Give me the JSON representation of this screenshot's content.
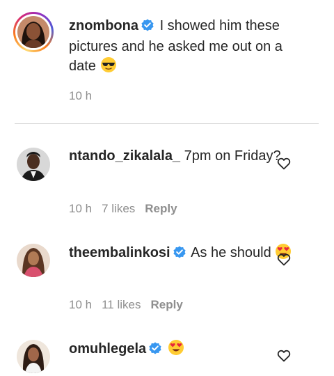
{
  "caption": {
    "username": "znombona",
    "text": "I showed him these pictures and he asked me out on a date",
    "emoji": "sunglasses-emoji",
    "time": "10 h"
  },
  "comments": [
    {
      "username": "ntando_zikalala_",
      "text": "7pm on Friday?",
      "time": "10 h",
      "likes": "7 likes",
      "reply_label": "Reply",
      "verified": false
    },
    {
      "username": "theembalinkosi",
      "text": "As he should",
      "emoji": "heart-eyes-emoji",
      "time": "10 h",
      "likes": "11 likes",
      "reply_label": "Reply",
      "verified": true
    },
    {
      "username": "omuhlegela",
      "emoji": "heart-eyes-emoji",
      "verified": true
    }
  ],
  "colors": {
    "verified_blue": "#3897f0",
    "meta_gray": "#8e8e8e",
    "text_dark": "#262626"
  }
}
